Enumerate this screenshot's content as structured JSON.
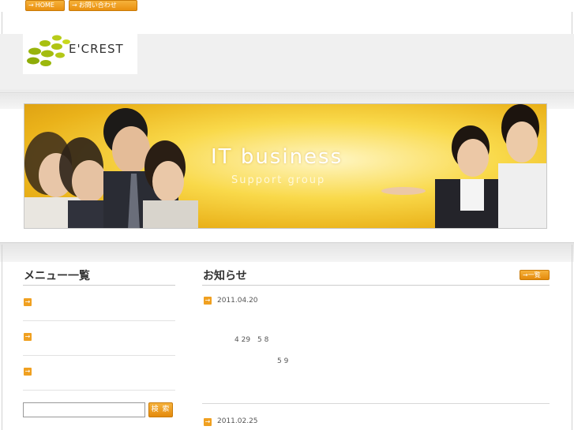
{
  "nav": {
    "home_label": "HOME",
    "contact_label": "お問い合わせ",
    "arrow_icon": "→"
  },
  "logo": {
    "text": "E'CREST"
  },
  "hero": {
    "line1": "IT  business",
    "line2": "Support group"
  },
  "menu": {
    "title": "メニュー一覧",
    "items": [
      {
        "icon": "→",
        "label": ""
      },
      {
        "icon": "→",
        "label": ""
      },
      {
        "icon": "→",
        "label": ""
      }
    ]
  },
  "search": {
    "value": "",
    "button_label": "検 索"
  },
  "news": {
    "title": "お知らせ",
    "list_button": "一覧",
    "entries": [
      {
        "date": "2011.04.20",
        "line1": "4 29　5 8",
        "line2": "5 9"
      },
      {
        "date": "2011.02.25"
      }
    ]
  },
  "colors": {
    "accent": "#f0a020",
    "band": "#f0f0f0"
  }
}
